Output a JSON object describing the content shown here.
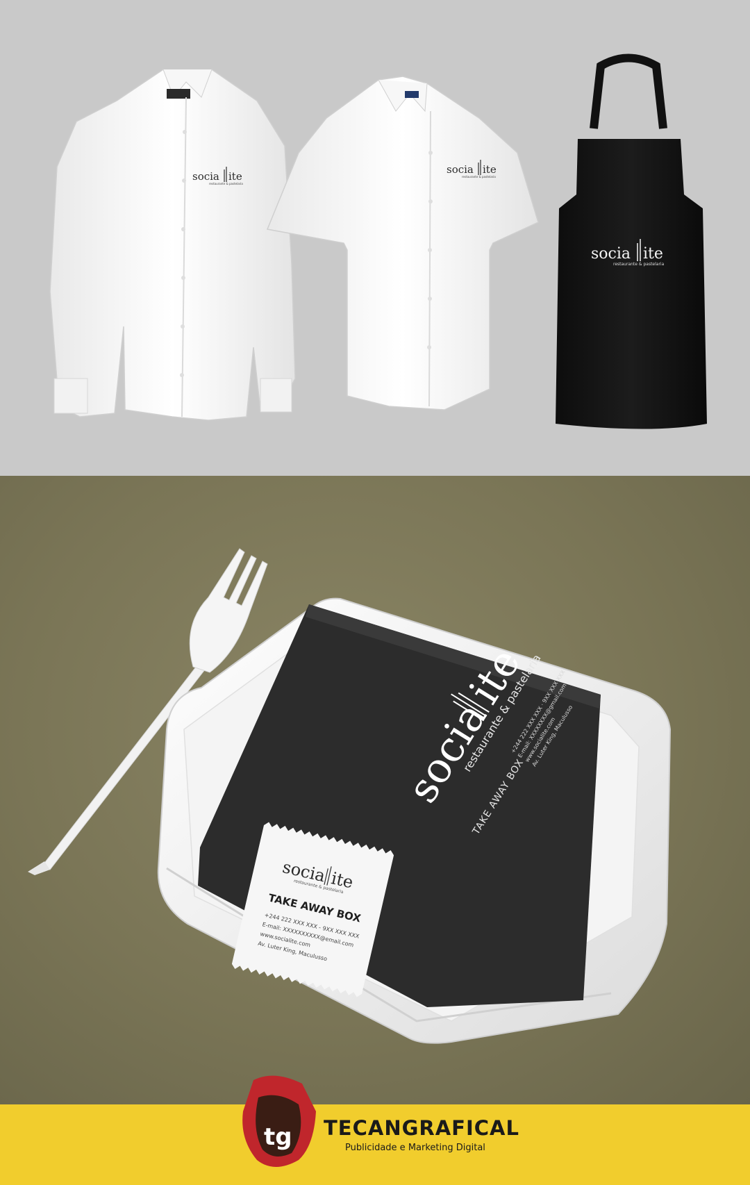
{
  "brand": {
    "name_part1": "socia",
    "name_part2": "ite",
    "tagline": "restaurante & pastelaria"
  },
  "box_sleeve": {
    "take_away": "TAKE AWAY BOX",
    "contact_phone": "+244 222 XXX XXX · 9XX XXX XXX",
    "contact_email": "E-mail: XXXXXXXX@gmail.com",
    "contact_web": "www.socialite.com",
    "contact_address": "Av. Luter King, Maculusso"
  },
  "box_label": {
    "take_away": "TAKE AWAY BOX",
    "phone": "+244 222 XXX XXX - 9XX XXX XXX",
    "email": "E-mail: XXXXXXXXXX@email.com",
    "web": "www.socialite.com",
    "address": "Av. Luter King, Maculusso"
  },
  "footer": {
    "logo_mark": "tg",
    "company": "TECANGRAFICAL",
    "slogan": "Publicidade e Marketing Digital"
  },
  "colors": {
    "top_background": "#c9c9c9",
    "table_background": "#7a7556",
    "footer_background": "#f1cd2d",
    "sleeve": "#2b2b2b",
    "logo_red": "#c0262c",
    "logo_dark": "#3a1d14"
  }
}
